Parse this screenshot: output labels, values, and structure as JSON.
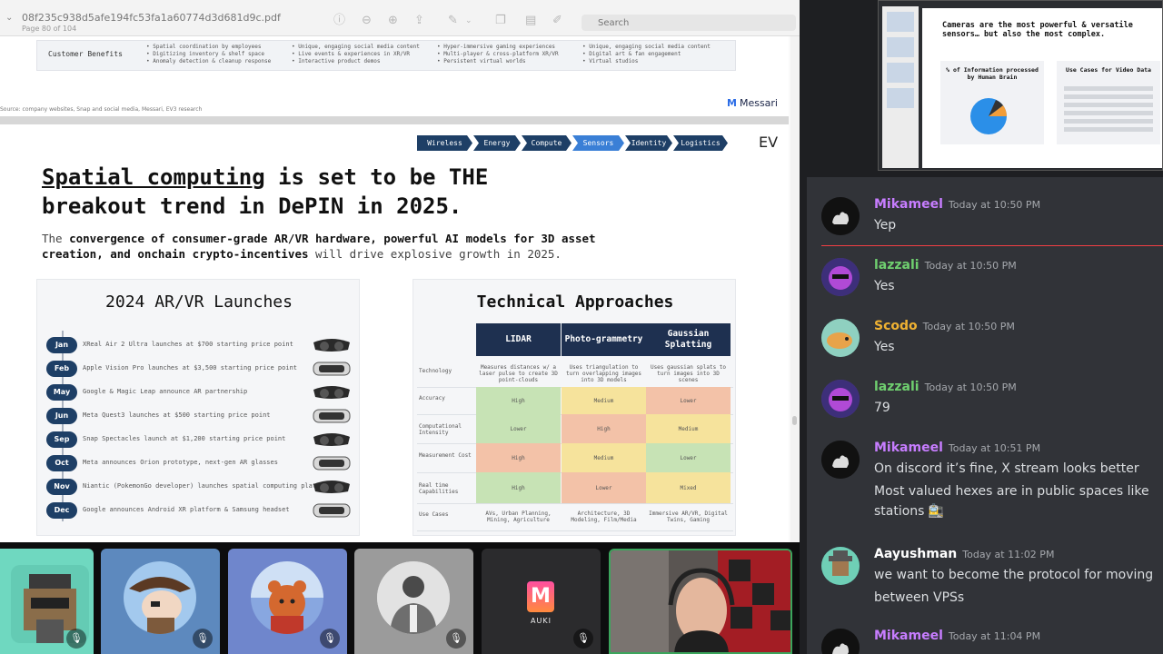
{
  "viewer": {
    "filename": "08f235c938d5afe194fc53fa1a60774d3d681d9c.pdf",
    "page_info": "Page 80 of 104",
    "search_placeholder": "Search"
  },
  "prev_page": {
    "row_label": "Customer Benefits",
    "columns": [
      [
        "• Spatial coordination by employees",
        "• Digitizing inventory & shelf space",
        "• Anomaly detection & cleanup response"
      ],
      [
        "• Unique, engaging social media content",
        "• Live events & experiences in XR/VR",
        "• Interactive product demos"
      ],
      [
        "• Hyper-immersive gaming experiences",
        "• Multi-player & cross-platform XR/VR",
        "• Persistent virtual worlds"
      ],
      [
        "• Unique, engaging social media content",
        "• Digital art & fan engagement",
        "• Virtual studios"
      ]
    ],
    "footnote": "Source: company websites, Snap and social media, Messari, EV3 research",
    "logo": "Messari"
  },
  "slide": {
    "nav_tabs": [
      {
        "label": "Wireless",
        "active": false
      },
      {
        "label": "Energy",
        "active": false
      },
      {
        "label": "Compute",
        "active": false
      },
      {
        "label": "Sensors",
        "active": true
      },
      {
        "label": "Identity",
        "active": false
      },
      {
        "label": "Logistics",
        "active": false
      }
    ],
    "logo": "EV",
    "title_underlined": "Spatial computing",
    "title_rest_1": " is set to be THE",
    "title_line2": "breakout trend in DePIN in 2025.",
    "subtitle_1a": "The ",
    "subtitle_1b": "convergence of consumer-grade AR/VR hardware, powerful AI models for 3D asset",
    "subtitle_2a": "creation, and onchain crypto-incentives",
    "subtitle_2b": " will drive explosive growth in 2025.",
    "launches": {
      "title": "2024 AR/VR Launches",
      "items": [
        {
          "month": "Jan",
          "text": "XReal Air 2 Ultra launches at $700 starting price point"
        },
        {
          "month": "Feb",
          "text": "Apple Vision Pro launches at $3,500 starting price point"
        },
        {
          "month": "May",
          "text": "Google & Magic Leap announce AR partnership"
        },
        {
          "month": "Jun",
          "text": "Meta Quest3 launches at $500 starting price point"
        },
        {
          "month": "Sep",
          "text": "Snap Spectacles launch at $1,200 starting price point"
        },
        {
          "month": "Oct",
          "text": "Meta announces Orion prototype, next-gen AR glasses"
        },
        {
          "month": "Nov",
          "text": "Niantic (PokemonGo developer) launches spatial computing platform"
        },
        {
          "month": "Dec",
          "text": "Google announces Android XR platform & Samsung headset"
        }
      ]
    },
    "approaches": {
      "title": "Technical Approaches",
      "headers": [
        "LIDAR",
        "Photo-grammetry",
        "Gaussian Splatting"
      ],
      "rows": [
        {
          "label": "Technology",
          "cells": [
            "Measures distances w/ a laser pulse to create 3D point-clouds",
            "Uses triangulation to turn overlapping images into 3D models",
            "Uses gaussian splats to turn images into 3D scenes"
          ]
        },
        {
          "label": "Accuracy",
          "cells": [
            "High",
            "Medium",
            "Lower"
          ]
        },
        {
          "label": "Computational Intensity",
          "cells": [
            "Lower",
            "High",
            "Medium"
          ]
        },
        {
          "label": "Measurement Cost",
          "cells": [
            "High",
            "Medium",
            "Lower"
          ]
        },
        {
          "label": "Real time Capabilities",
          "cells": [
            "High",
            "Lower",
            "Mixed"
          ]
        },
        {
          "label": "Use Cases",
          "cells": [
            "AVs, Urban Planning, Mining, Agriculture",
            "Architecture, 3D Modeling, Film/Media",
            "Immersive AR/VR, Digital Twins, Gaming"
          ]
        }
      ],
      "colors": {
        "green": "#c7e3b5",
        "yellow": "#f6e39c",
        "red": "#f3c2a8"
      }
    }
  },
  "video": {
    "auki_label": "AUKI"
  },
  "preview": {
    "title_1": "Cameras are the most powerful & versatile",
    "title_2": "sensors… but also the most complex.",
    "left_heading": "% of Information processed by Human Brain",
    "right_heading": "Use Cases for Video Data"
  },
  "chat": {
    "messages": [
      {
        "name": "Mikameel",
        "name_color": "#c77dff",
        "time": "Today at 10:50 PM",
        "lines": [
          "Yep"
        ]
      },
      {
        "name": "lazzali",
        "name_color": "#6fcf6f",
        "time": "Today at 10:50 PM",
        "lines": [
          "Yes"
        ]
      },
      {
        "name": "Scodo",
        "name_color": "#f0b232",
        "time": "Today at 10:50 PM",
        "lines": [
          "Yes"
        ]
      },
      {
        "name": "lazzali",
        "name_color": "#6fcf6f",
        "time": "Today at 10:50 PM",
        "lines": [
          "79"
        ]
      },
      {
        "name": "Mikameel",
        "name_color": "#c77dff",
        "time": "Today at 10:51 PM",
        "lines": [
          "On discord it’s fine, X stream looks better",
          "Most valued hexes are in public spaces like",
          "stations 🚉"
        ]
      },
      {
        "name": "Aayushman",
        "name_color": "#ffffff",
        "time": "Today at 11:02 PM",
        "lines": [
          "we want to become the protocol for moving",
          "between VPSs"
        ]
      },
      {
        "name": "Mikameel",
        "name_color": "#c77dff",
        "time": "Today at 11:04 PM",
        "lines": []
      }
    ]
  }
}
